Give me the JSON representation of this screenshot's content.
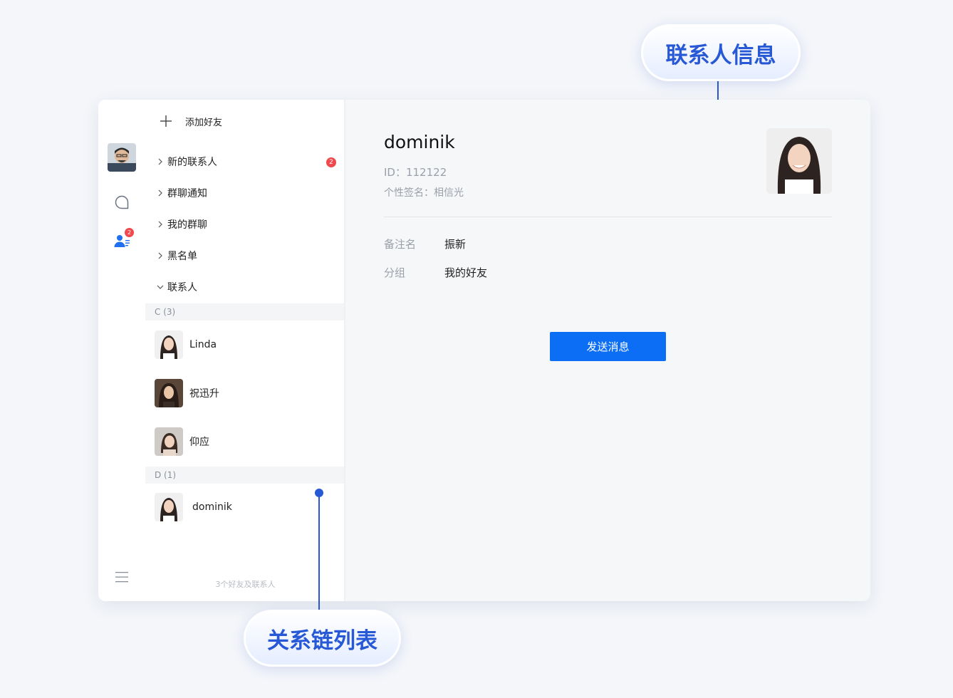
{
  "callouts": {
    "contact_info": "联系人信息",
    "relation_list": "关系链列表"
  },
  "rail": {
    "contacts_badge": "2"
  },
  "list": {
    "add_friend_label": "添加好友",
    "nav": [
      {
        "label": "新的联系人",
        "badge": "2"
      },
      {
        "label": "群聊通知"
      },
      {
        "label": "我的群聊"
      },
      {
        "label": "黑名单"
      },
      {
        "label": "联系人"
      }
    ],
    "groups": [
      {
        "header": "C (3)",
        "contacts": [
          {
            "name": "Linda"
          },
          {
            "name": "祝迅升"
          },
          {
            "name": "仰应"
          }
        ]
      },
      {
        "header": "D (1)",
        "contacts": [
          {
            "name": "dominik"
          }
        ]
      }
    ],
    "footer": "3个好友及联系人"
  },
  "detail": {
    "name": "dominik",
    "id_text": "ID：112122",
    "signature": "个性签名：相信光",
    "fields": [
      {
        "label": "备注名",
        "value": "振新"
      },
      {
        "label": "分组",
        "value": "我的好友"
      }
    ],
    "send_button": "发送消息"
  },
  "colors": {
    "accent": "#0b6ef5",
    "callout_text": "#2758d6",
    "badge": "#f0484c"
  }
}
